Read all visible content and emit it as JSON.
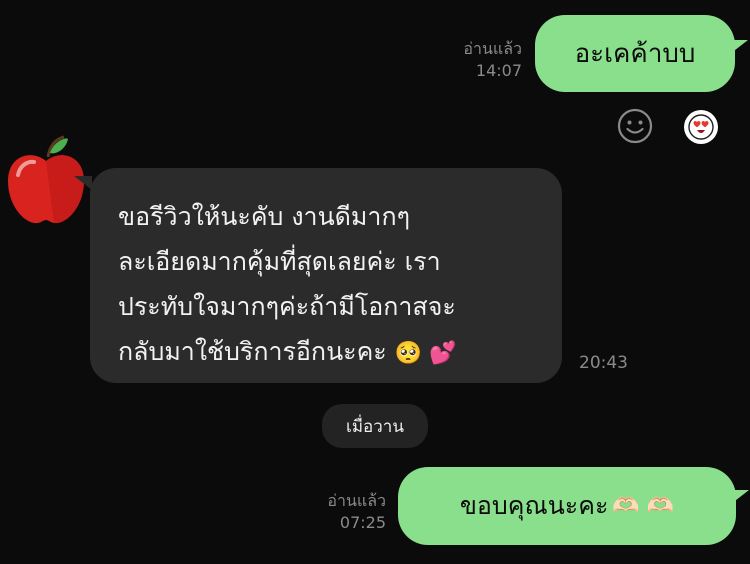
{
  "messages": [
    {
      "direction": "outgoing",
      "text": "อะเคค้าบบ",
      "read_label": "อ่านแล้ว",
      "time": "14:07"
    },
    {
      "direction": "incoming",
      "sender_avatar": "red-apple-emoji",
      "lines": [
        "ขอรีวิวให้นะคับ งานดีมากๆ",
        "ละเอียดมากคุ้มที่สุดเลยค่ะ เรา",
        "ประทับใจมากๆค่ะถ้ามีโอกาสจะ",
        "กลับมาใช้บริการอีกนะคะ"
      ],
      "trailing_emoji": "🥺 💕",
      "time": "20:43"
    },
    {
      "direction": "outgoing",
      "text": "ขอบคุณนะคะ",
      "trailing_emoji": "🫶🏻 🫶🏻",
      "read_label": "อ่านแล้ว",
      "time": "07:25"
    }
  ],
  "date_separator": "เมื่อวาน",
  "reactions": {
    "add_icon": "smiley-face-icon",
    "selected_icon": "heart-eyes-emoji-icon"
  },
  "colors": {
    "background": "#0b0b0b",
    "outgoing_bubble": "#89df8b",
    "incoming_bubble": "#2b2b2b",
    "meta_text": "#8a8a8a"
  }
}
